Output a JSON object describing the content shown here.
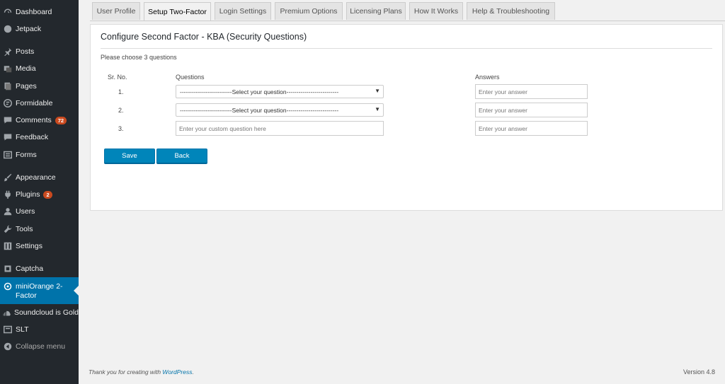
{
  "sidebar": {
    "items": [
      {
        "label": "Dashboard",
        "icon": "dashboard-icon"
      },
      {
        "label": "Jetpack",
        "icon": "jetpack-icon"
      },
      {
        "label": "Posts",
        "icon": "pin-icon"
      },
      {
        "label": "Media",
        "icon": "media-icon"
      },
      {
        "label": "Pages",
        "icon": "pages-icon"
      },
      {
        "label": "Formidable",
        "icon": "formidable-icon"
      },
      {
        "label": "Comments",
        "icon": "comment-icon",
        "badge": "72"
      },
      {
        "label": "Feedback",
        "icon": "feedback-icon"
      },
      {
        "label": "Forms",
        "icon": "forms-icon"
      },
      {
        "label": "Appearance",
        "icon": "brush-icon"
      },
      {
        "label": "Plugins",
        "icon": "plug-icon",
        "badge": "2"
      },
      {
        "label": "Users",
        "icon": "users-icon"
      },
      {
        "label": "Tools",
        "icon": "wrench-icon"
      },
      {
        "label": "Settings",
        "icon": "settings-icon"
      },
      {
        "label": "Captcha",
        "icon": "captcha-icon"
      },
      {
        "label": "miniOrange 2-Factor",
        "icon": "miniorange-icon"
      },
      {
        "label": "Soundcloud is Gold",
        "icon": "soundcloud-icon"
      },
      {
        "label": "SLT",
        "icon": "slt-icon"
      },
      {
        "label": "Collapse menu",
        "icon": "collapse-icon"
      }
    ]
  },
  "tabs": [
    {
      "label": "User Profile"
    },
    {
      "label": "Setup Two-Factor"
    },
    {
      "label": "Login Settings"
    },
    {
      "label": "Premium Options"
    },
    {
      "label": "Licensing Plans"
    },
    {
      "label": "How It Works"
    },
    {
      "label": "Help & Troubleshooting"
    }
  ],
  "active_tab": "Setup Two-Factor",
  "panel": {
    "title": "Configure Second Factor - KBA (Security Questions)",
    "instruction": "Please choose 3 questions",
    "headers": {
      "sr_no": "Sr. No.",
      "questions": "Questions",
      "answers": "Answers"
    },
    "rows": [
      {
        "num": "1.",
        "question_select": "--------------------------Select your question--------------------------",
        "answer_placeholder": "Enter your answer"
      },
      {
        "num": "2.",
        "question_select": "--------------------------Select your question--------------------------",
        "answer_placeholder": "Enter your answer"
      },
      {
        "num": "3.",
        "custom_placeholder": "Enter your custom question here",
        "answer_placeholder": "Enter your answer"
      }
    ],
    "save_label": "Save",
    "back_label": "Back"
  },
  "footer": {
    "thanks_prefix": "Thank you for creating with ",
    "thanks_link": "WordPress",
    "thanks_suffix": ".",
    "version": "Version 4.8"
  },
  "colors": {
    "sidebar_bg": "#23282d",
    "active_menu": "#0073aa",
    "button": "#0085ba",
    "badge": "#ca4a1f"
  }
}
